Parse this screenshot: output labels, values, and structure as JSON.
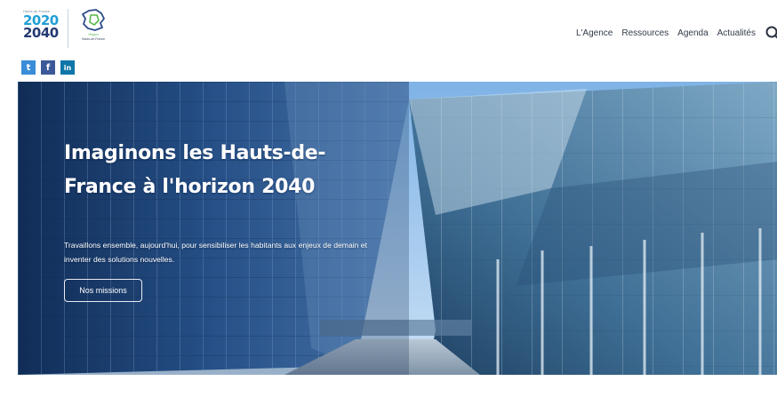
{
  "logo": {
    "tiny_label": "Hauts-de-France",
    "year_top": "2020",
    "year_bottom": "2040",
    "region_label_top": "Région",
    "region_label_bottom": "Hauts-de-France"
  },
  "social": {
    "twitter": "t",
    "facebook": "f",
    "linkedin": "in"
  },
  "nav": {
    "items": [
      "L'Agence",
      "Ressources",
      "Agenda",
      "Actualités"
    ]
  },
  "hero": {
    "title": "Imaginons les Hauts-de-France à l'horizon 2040",
    "text": "Travaillons ensemble, aujourd'hui, pour sensibiliser les habitants aux enjeux de demain et inventer des solutions nouvelles.",
    "button_label": "Nos missions"
  },
  "colors": {
    "year_top": "#1f9fd6",
    "year_bottom": "#243a73",
    "twitter": "#3a8dd8",
    "facebook": "#3b5998",
    "linkedin": "#0e76a8",
    "sky": "#a9cdf0",
    "glass_dark": "#1c3f73"
  }
}
